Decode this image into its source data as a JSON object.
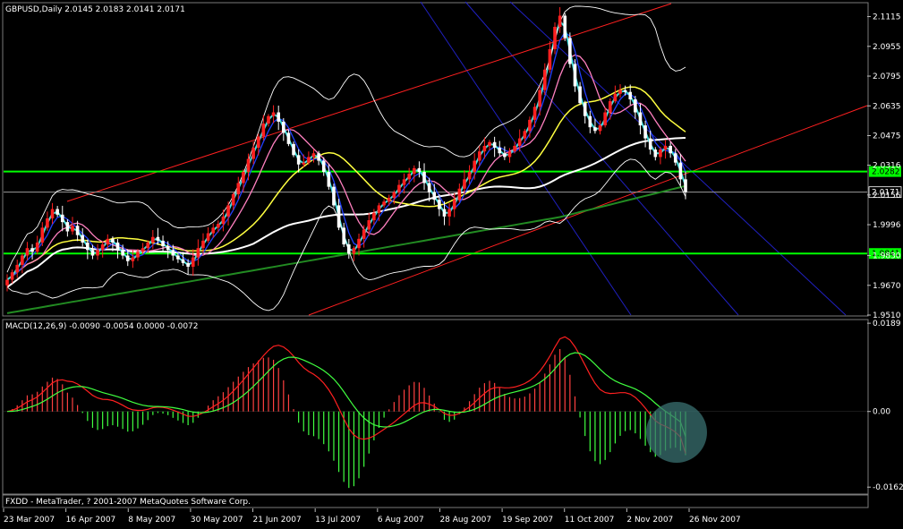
{
  "header": {
    "main_title": "GBPUSD,Daily  2.0145 2.0183 2.0141 2.0171",
    "macd_title": "MACD(12,26,9) -0.0090 -0.0054 0.0000 -0.0072",
    "footer_text": "FXDD - MetaTrader, ? 2001-2007 MetaQuotes Software Corp."
  },
  "colors": {
    "background": "#000000",
    "bull_candle": "#ff2020",
    "bear_candle": "#ffffff",
    "cyan_ma": "#40e0e0",
    "blue_ma": "#2040ff",
    "pink_ma": "#ff80c0",
    "yellow_ma": "#ffff40",
    "white_ma": "#ffffff",
    "green_ma": "#228b22",
    "bands": "#ffffff",
    "support_resistance": "#00ff00",
    "trend_channel": "#ff2020",
    "down_channel": "#2020c0",
    "macd_line": "#ff2020",
    "signal_line": "#40ff40",
    "hist_up": "#ff4040",
    "hist_down": "#40ff40",
    "highlight": "#3a7070"
  },
  "chart_data": [
    {
      "type": "candlestick",
      "symbol": "GBPUSD",
      "timeframe": "Daily",
      "ohlc_last": {
        "open": 2.0145,
        "high": 2.0183,
        "low": 2.0141,
        "close": 2.0171
      },
      "ylim": [
        1.951,
        2.1185
      ],
      "y_ticks": [
        "2.1115",
        "2.0955",
        "2.0795",
        "2.0635",
        "2.0475",
        "2.0316",
        "2.0156",
        "1.9996",
        "1.9830",
        "1.9670",
        "1.9510"
      ],
      "x_ticks": [
        "23 Mar 2007",
        "16 Apr 2007",
        "8 May 2007",
        "30 May 2007",
        "21 Jun 2007",
        "13 Jul 2007",
        "6 Aug 2007",
        "28 Aug 2007",
        "19 Sep 2007",
        "11 Oct 2007",
        "2 Nov 2007",
        "26 Nov 2007"
      ],
      "horizontal_levels": [
        {
          "value": 2.0282,
          "label": "2.0282"
        },
        {
          "value": 1.9841,
          "label": "1.9841"
        }
      ],
      "current_price_label": "2.0171",
      "close_series": [
        1.97,
        1.974,
        1.978,
        1.983,
        1.987,
        1.985,
        1.99,
        1.998,
        2.003,
        2.008,
        2.005,
        2.001,
        1.996,
        1.999,
        1.994,
        1.99,
        1.986,
        1.983,
        1.986,
        1.989,
        1.992,
        1.99,
        1.986,
        1.983,
        1.98,
        1.982,
        1.985,
        1.987,
        1.99,
        1.993,
        1.991,
        1.988,
        1.986,
        1.983,
        1.981,
        1.979,
        1.977,
        1.982,
        1.987,
        1.991,
        1.995,
        1.998,
        2.0,
        2.004,
        2.01,
        2.016,
        2.022,
        2.028,
        2.035,
        2.041,
        2.047,
        2.054,
        2.058,
        2.06,
        2.055,
        2.049,
        2.043,
        2.037,
        2.032,
        2.033,
        2.036,
        2.038,
        2.034,
        2.028,
        2.02,
        2.01,
        1.998,
        1.989,
        1.984,
        1.987,
        1.992,
        1.997,
        2.002,
        2.006,
        2.01,
        2.012,
        2.014,
        2.017,
        2.021,
        2.024,
        2.027,
        2.03,
        2.028,
        2.022,
        2.017,
        2.013,
        2.008,
        2.004,
        2.008,
        2.013,
        2.019,
        2.024,
        2.028,
        2.034,
        2.039,
        2.042,
        2.044,
        2.041,
        2.038,
        2.036,
        2.039,
        2.042,
        2.046,
        2.05,
        2.056,
        2.063,
        2.072,
        2.083,
        2.094,
        2.106,
        2.112,
        2.1,
        2.086,
        2.074,
        2.065,
        2.058,
        2.052,
        2.05,
        2.053,
        2.06,
        2.066,
        2.07,
        2.072,
        2.071,
        2.067,
        2.06,
        2.053,
        2.046,
        2.04,
        2.036,
        2.04,
        2.042,
        2.038,
        2.033,
        2.024,
        2.0171
      ],
      "series": [
        {
          "name": "",
          "color_key": "cyan_ma"
        },
        {
          "name": "",
          "color_key": "blue_ma"
        },
        {
          "name": "",
          "color_key": "pink_ma"
        },
        {
          "name": "",
          "color_key": "yellow_ma"
        },
        {
          "name": "",
          "color_key": "white_ma"
        },
        {
          "name": "",
          "color_key": "green_ma"
        }
      ]
    },
    {
      "type": "macd",
      "params": "12,26,9",
      "values": {
        "macd": -0.009,
        "signal": -0.0054,
        "third": 0.0,
        "histogram": -0.0072
      },
      "ylim": [
        -0.0175,
        0.0195
      ],
      "y_ticks": [
        "0.0189",
        "0.00",
        "-0.0162"
      ]
    }
  ]
}
